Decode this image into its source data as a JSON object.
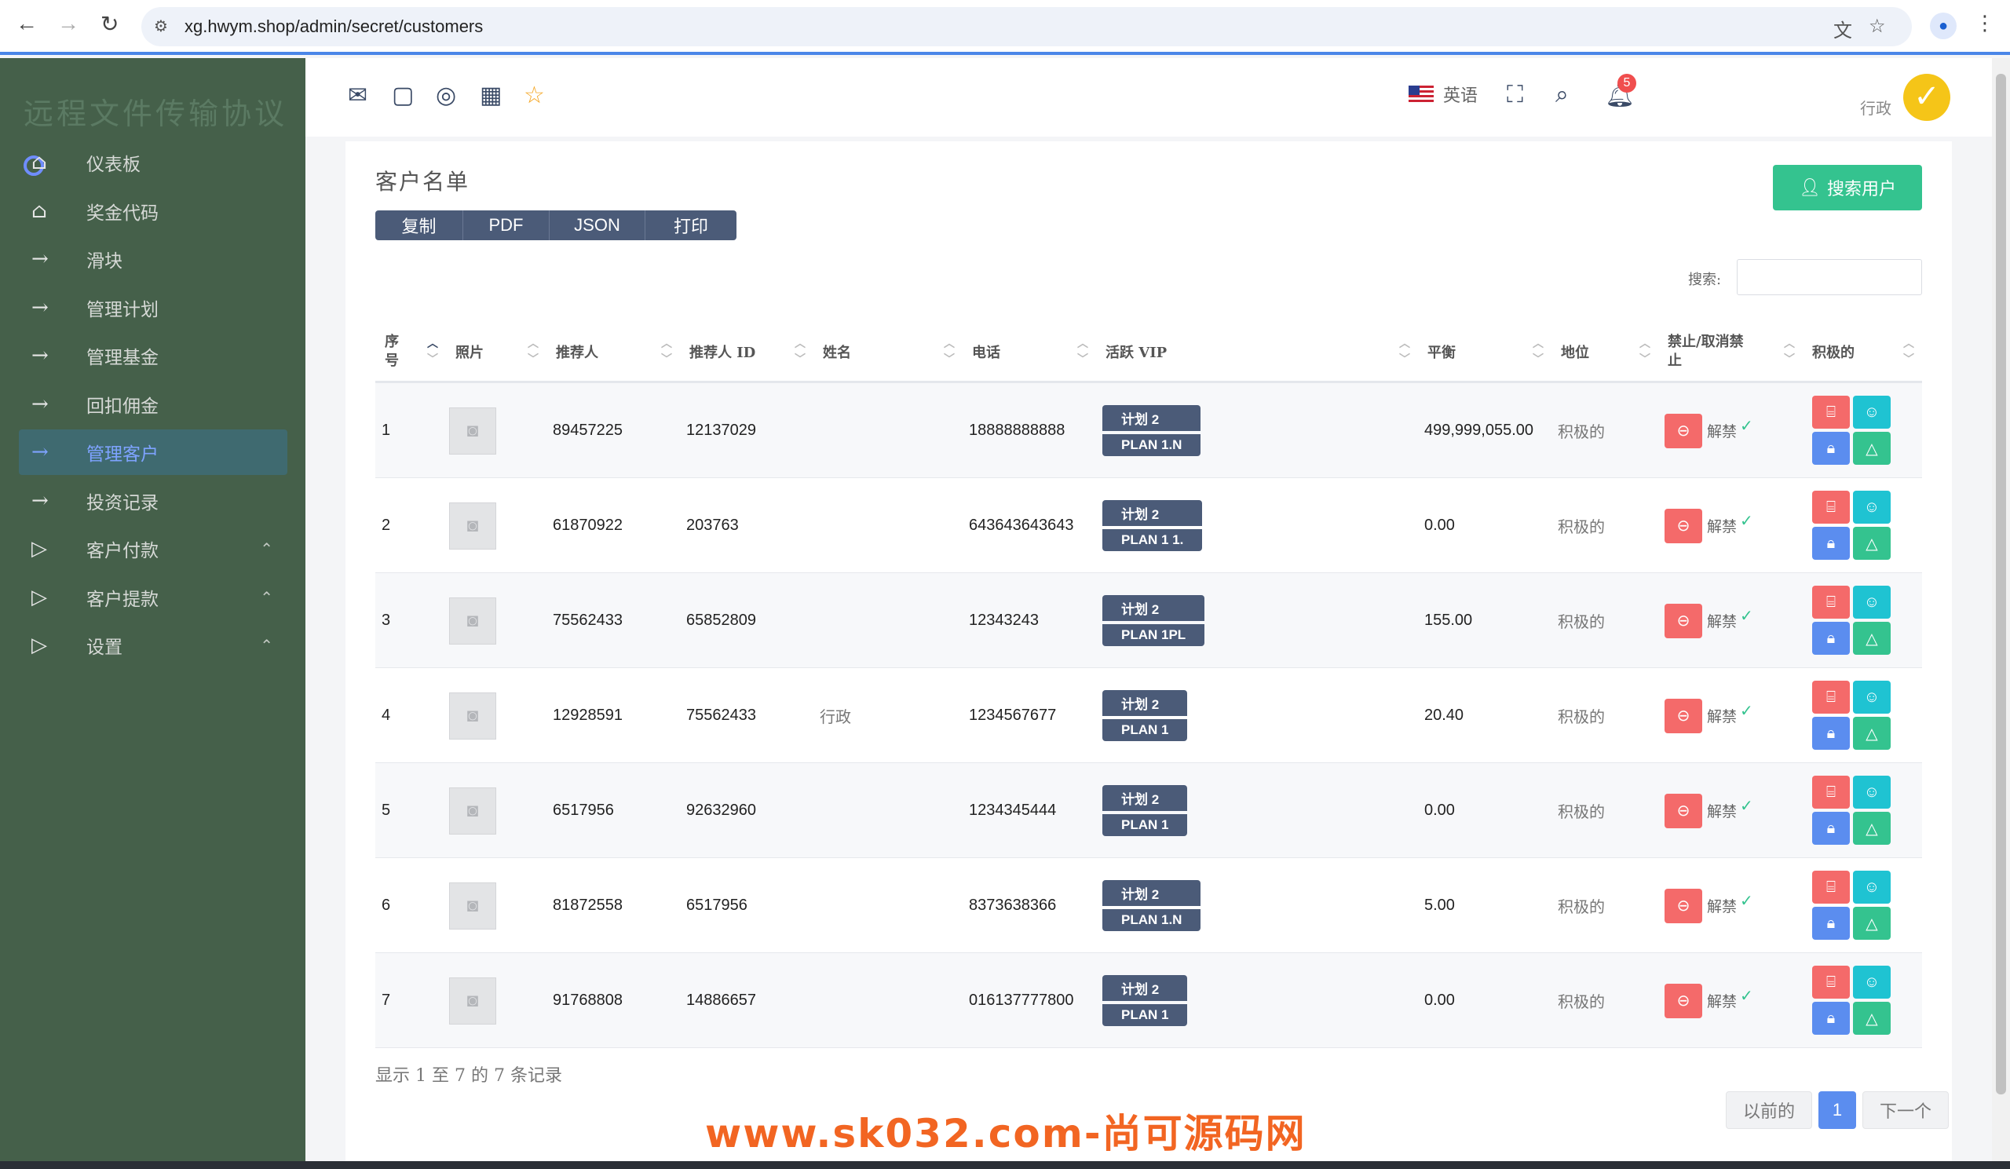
{
  "browser": {
    "url": "xg.hwym.shop/admin/secret/customers"
  },
  "sidebar": {
    "brand": "远程文件传输协议",
    "items": [
      {
        "label": "仪表板",
        "icon": "home-icon"
      },
      {
        "label": "奖金代码",
        "icon": "home-icon"
      },
      {
        "label": "滑块",
        "icon": "arrow-right-icon"
      },
      {
        "label": "管理计划",
        "icon": "arrow-right-icon"
      },
      {
        "label": "管理基金",
        "icon": "arrow-right-icon"
      },
      {
        "label": "回扣佣金",
        "icon": "arrow-right-icon"
      },
      {
        "label": "管理客户",
        "icon": "arrow-right-icon",
        "active": true
      },
      {
        "label": "投资记录",
        "icon": "arrow-right-icon"
      },
      {
        "label": "客户付款",
        "icon": "play-icon"
      },
      {
        "label": "客户提款",
        "icon": "play-icon"
      },
      {
        "label": "设置",
        "icon": "play-icon"
      }
    ]
  },
  "topbar": {
    "language": "英语",
    "notification_count": "5",
    "role": "行政"
  },
  "page": {
    "title": "客户名单",
    "search_user_button": "搜索用户",
    "export_buttons": [
      "复制",
      "PDF",
      "JSON",
      "打印"
    ],
    "search_label": "搜索:",
    "footer_info": "显示 1 至 7 的 7 条记录",
    "pager": {
      "prev": "以前的",
      "current": "1",
      "next": "下一个"
    }
  },
  "table": {
    "headers": [
      "序号",
      "照片",
      "推荐人",
      "推荐人 ID",
      "姓名",
      "电话",
      "活跃 VIP",
      "平衡",
      "地位",
      "禁止/取消禁止",
      "积极的"
    ],
    "rows": [
      {
        "no": "1",
        "referrer": "89457225",
        "referrer_id": "12137029",
        "name": "",
        "phone": "18888888888",
        "vip1": "计划 2",
        "vip2": "PLAN 1.N",
        "balance": "499,999,055.00",
        "status": "积极的",
        "unban": "解禁"
      },
      {
        "no": "2",
        "referrer": "61870922",
        "referrer_id": "203763",
        "name": "",
        "phone": "643643643643",
        "vip1": "计划 2",
        "vip2": "PLAN 1 1.",
        "balance": "0.00",
        "status": "积极的",
        "unban": "解禁"
      },
      {
        "no": "3",
        "referrer": "75562433",
        "referrer_id": "65852809",
        "name": "",
        "phone": "12343243",
        "vip1": "计划 2",
        "vip2": "PLAN 1PL",
        "balance": "155.00",
        "status": "积极的",
        "unban": "解禁"
      },
      {
        "no": "4",
        "referrer": "12928591",
        "referrer_id": "75562433",
        "name": "行政",
        "phone": "1234567677",
        "vip1": "计划 2",
        "vip2": "PLAN 1",
        "balance": "20.40",
        "status": "积极的",
        "unban": "解禁"
      },
      {
        "no": "5",
        "referrer": "6517956",
        "referrer_id": "92632960",
        "name": "",
        "phone": "1234345444",
        "vip1": "计划 2",
        "vip2": "PLAN 1",
        "balance": "0.00",
        "status": "积极的",
        "unban": "解禁"
      },
      {
        "no": "6",
        "referrer": "81872558",
        "referrer_id": "6517956",
        "name": "",
        "phone": "8373638366",
        "vip1": "计划 2",
        "vip2": "PLAN 1.N",
        "balance": "5.00",
        "status": "积极的",
        "unban": "解禁"
      },
      {
        "no": "7",
        "referrer": "91768808",
        "referrer_id": "14886657",
        "name": "",
        "phone": "016137777800",
        "vip1": "计划 2",
        "vip2": "PLAN 1",
        "balance": "0.00",
        "status": "积极的",
        "unban": "解禁"
      }
    ]
  },
  "watermark": "www.sk032.com-尚可源码网",
  "colors": {
    "sidebar": "#45604a",
    "accent": "#5b8def",
    "success": "#34c38f",
    "danger": "#f46a6a",
    "dark_button": "#4b5b78"
  }
}
